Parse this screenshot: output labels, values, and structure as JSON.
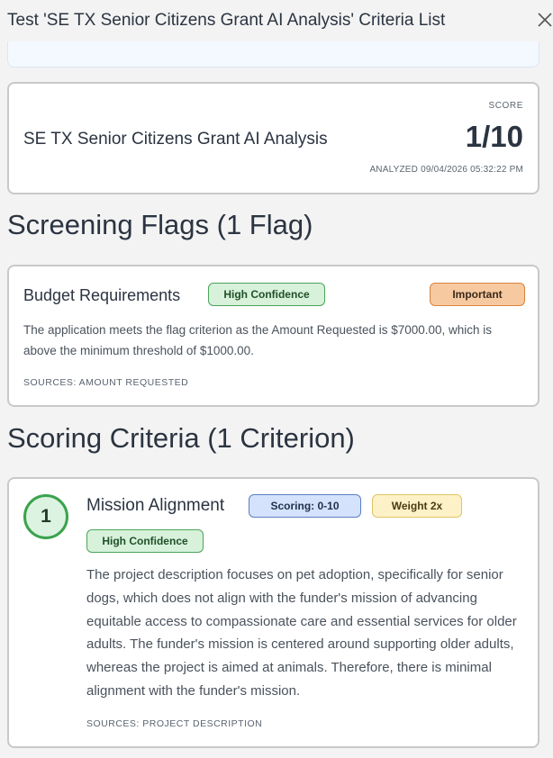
{
  "modal": {
    "title": "Test 'SE TX Senior Citizens Grant AI Analysis' Criteria List",
    "close_icon": "close-icon"
  },
  "summary": {
    "analysis_name": "SE TX Senior Citizens Grant AI Analysis",
    "score_label": "SCORE",
    "score_value": "1/10",
    "analyzed_at": "ANALYZED 09/04/2026 05:32:22 PM"
  },
  "screening_flags": {
    "heading": "Screening Flags (1 Flag)",
    "items": [
      {
        "name": "Budget Requirements",
        "confidence": "High Confidence",
        "importance": "Important",
        "description": "The application meets the flag criterion as the Amount Requested is $7000.00, which is above the minimum threshold of $1000.00.",
        "sources": "SOURCES: AMOUNT REQUESTED"
      }
    ]
  },
  "scoring_criteria": {
    "heading": "Scoring Criteria (1 Criterion)",
    "items": [
      {
        "number": "1",
        "name": "Mission Alignment",
        "scoring": "Scoring: 0-10",
        "weight": "Weight 2x",
        "confidence": "High Confidence",
        "description": "The project description focuses on pet adoption, specifically for senior dogs, which does not align with the funder's mission of advancing equitable access to compassionate care and essential services for older adults. The funder's mission is centered around supporting older adults, whereas the project is aimed at animals. Therefore, there is minimal alignment with the funder's mission.",
        "sources": "SOURCES: PROJECT DESCRIPTION"
      }
    ]
  },
  "colors": {
    "background": "#f3f3f3",
    "card": "#ffffff",
    "high_confidence": "#d7f1db",
    "important": "#f7c9a1",
    "scoring": "#d5e2fb",
    "weight": "#fdf1c8",
    "criterion_ring": "#3aa34d"
  }
}
